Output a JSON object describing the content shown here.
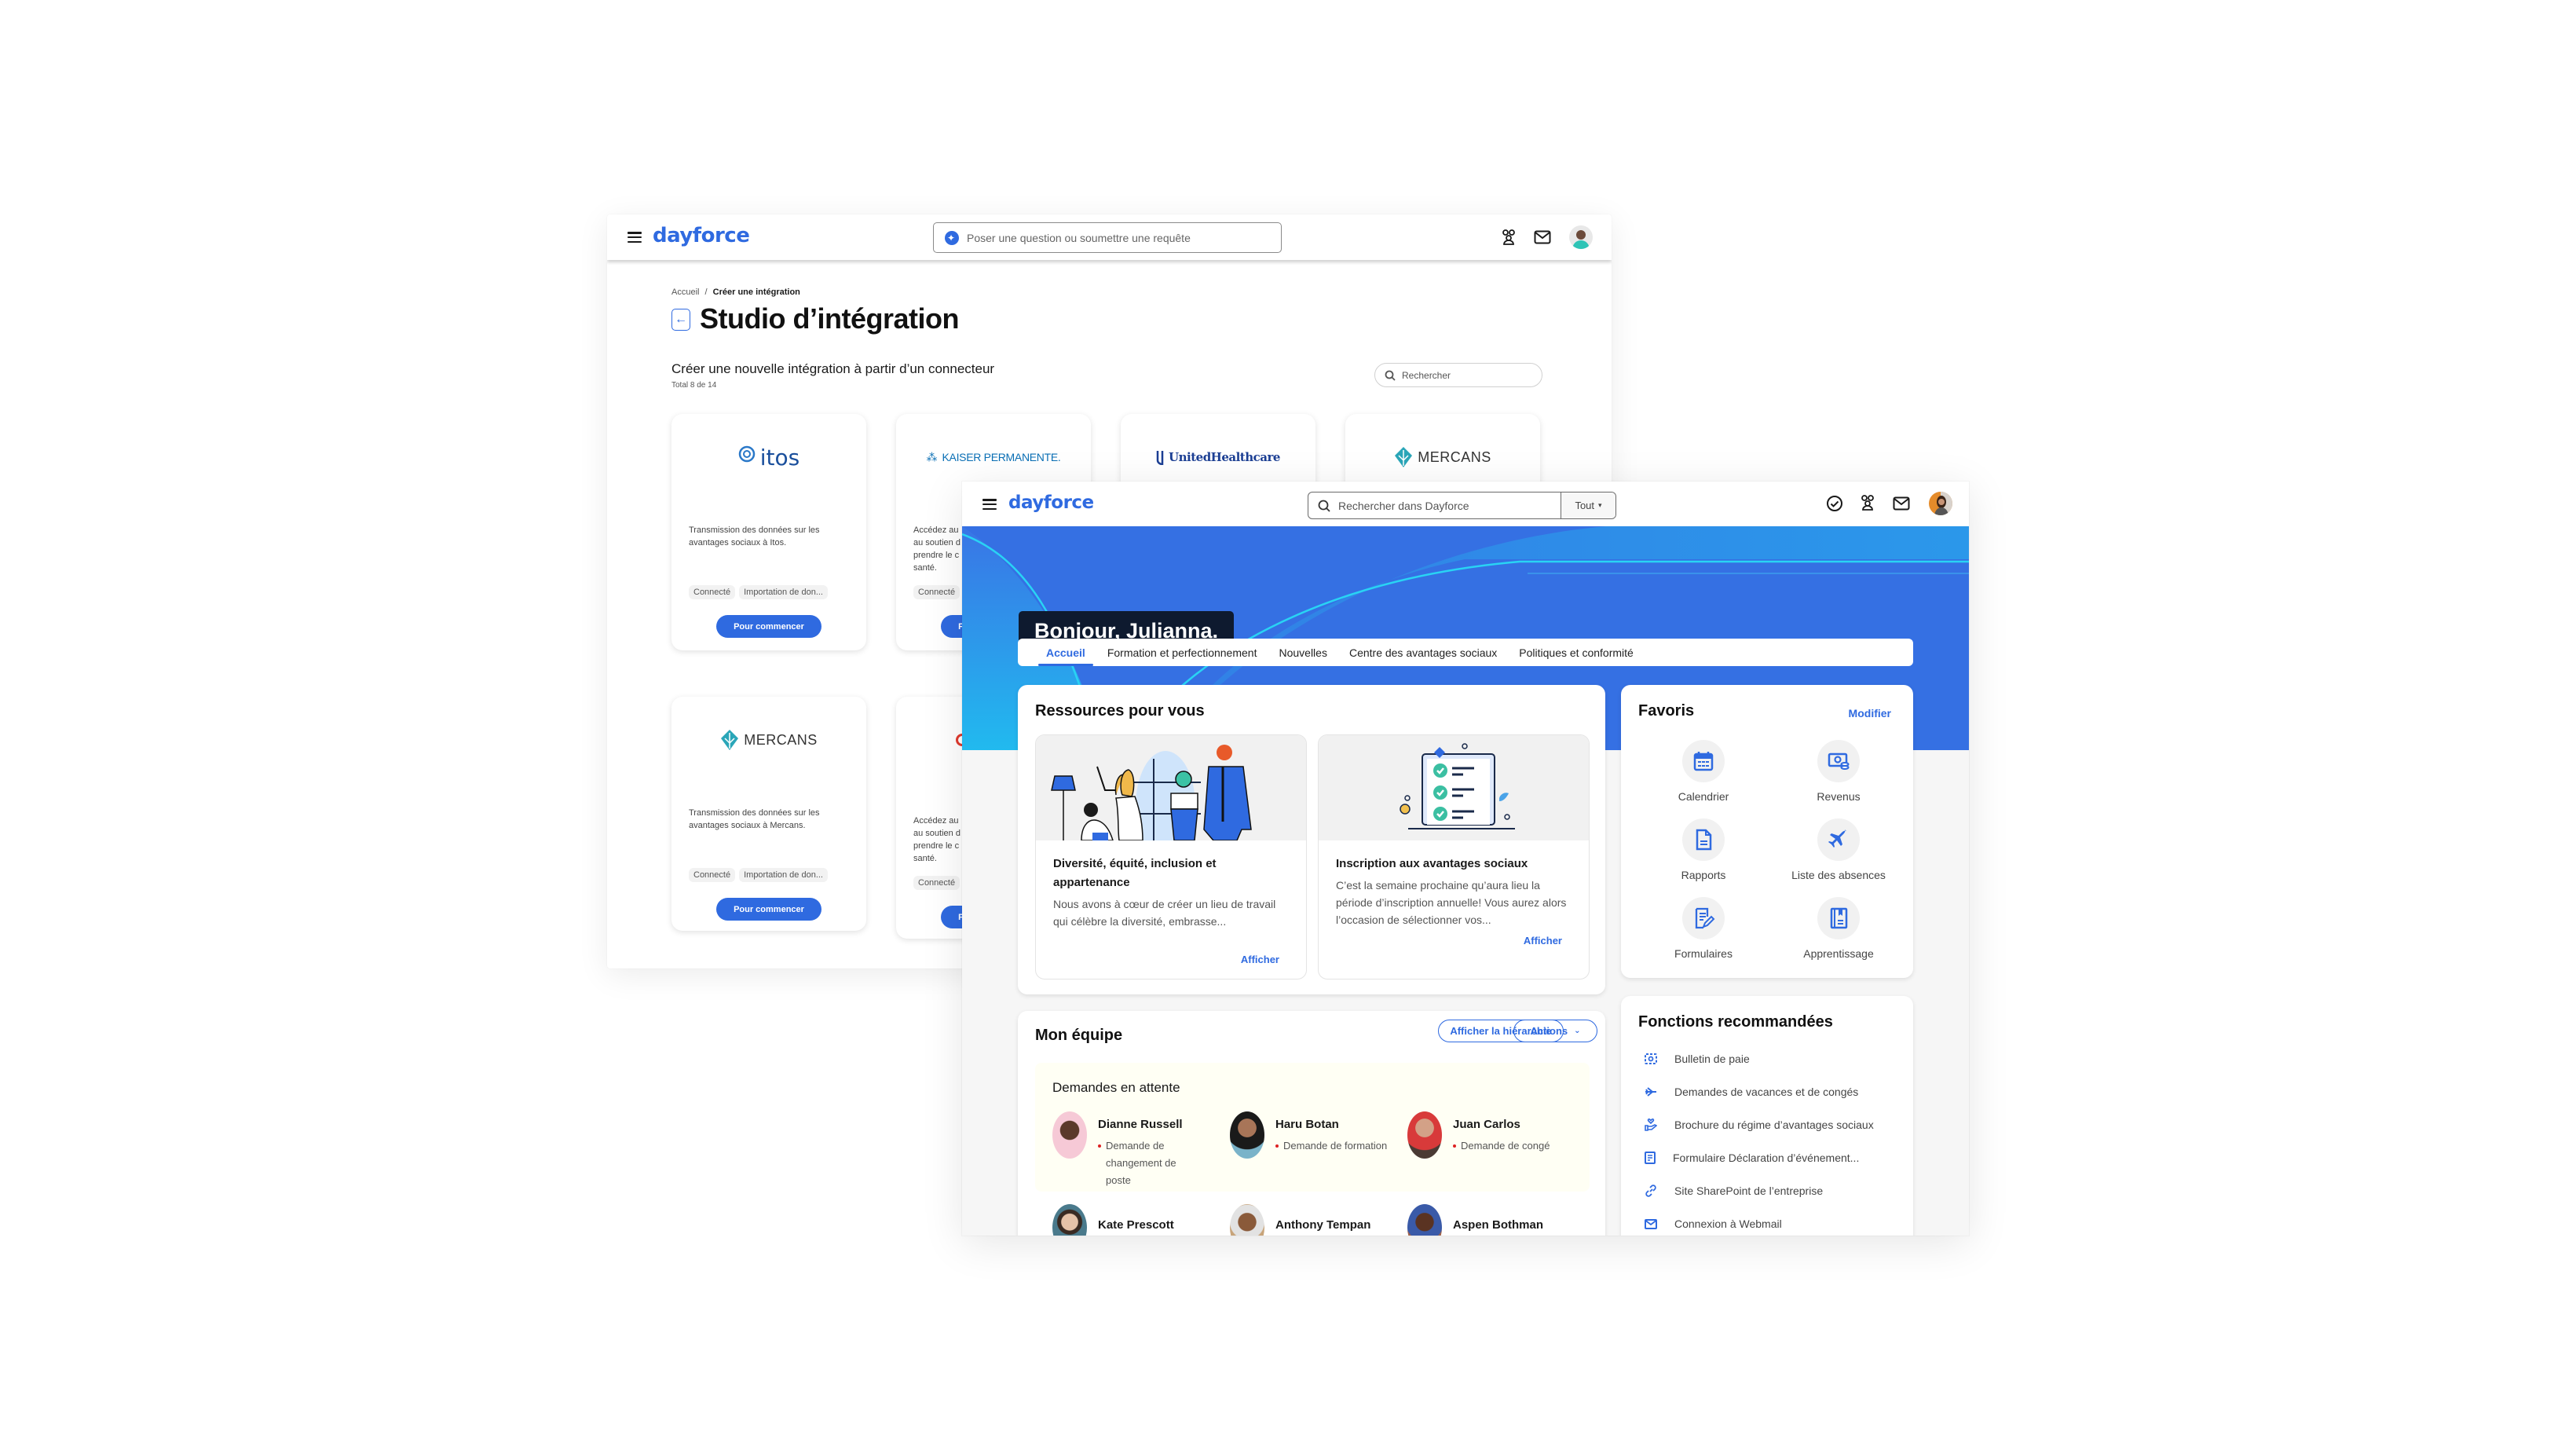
{
  "back_window": {
    "logo": "dayforce",
    "search_placeholder": "Poser une question ou soumettre une requête",
    "breadcrumb": {
      "home": "Accueil",
      "separator": "/",
      "current": "Créer une intégration"
    },
    "title": "Studio d’intégration",
    "subtitle": "Créer une nouvelle intégration à partir d’un connecteur",
    "total": "Total 8 de 14",
    "search_placeholder_connectors": "Rechercher",
    "connectors": [
      {
        "name": "itos",
        "description": "Transmission des données sur les avantages sociaux à Itos.",
        "tags": [
          "Connecté",
          "Importation de don..."
        ],
        "button": "Pour commencer"
      },
      {
        "name": "KAISER PERMANENTE.",
        "description": "Accédez aux ... au soutien d... prendre le c... santé.",
        "tags": [
          "Connecté"
        ],
        "button": "Pour commencer"
      },
      {
        "name": "UnitedHealthcare",
        "description": "",
        "tags": [],
        "button": ""
      },
      {
        "name": "MERCANS",
        "description": "",
        "tags": [],
        "button": ""
      },
      {
        "name": "MERCANS",
        "description": "Transmission des données sur les avantages sociaux à Mercans.",
        "tags": [
          "Connecté",
          "Importation de don..."
        ],
        "button": "Pour commencer"
      },
      {
        "name": "",
        "description": "Accédez aux ... au soutien d... prendre le c... santé.",
        "tags": [
          "Connecté"
        ],
        "button": "Pour commencer"
      }
    ],
    "colors": {
      "accent": "#2f6ae0"
    }
  },
  "front_window": {
    "logo": "dayforce",
    "search_placeholder": "Rechercher dans Dayforce",
    "search_scope": "Tout",
    "greeting": "Bonjour, Julianna.",
    "tabs": [
      {
        "label": "Accueil",
        "active": true
      },
      {
        "label": "Formation et perfectionnement",
        "active": false
      },
      {
        "label": "Nouvelles",
        "active": false
      },
      {
        "label": "Centre des avantages sociaux",
        "active": false
      },
      {
        "label": "Politiques et conformité",
        "active": false
      }
    ],
    "resources": {
      "title": "Ressources pour vous",
      "items": [
        {
          "title": "Diversité, équité, inclusion et appartenance",
          "body": "Nous avons à cœur de créer un lieu de travail qui célèbre la diversité, embrasse...",
          "link": "Afficher"
        },
        {
          "title": "Inscription aux avantages sociaux",
          "body": "C’est la semaine prochaine qu’aura lieu la période d’inscription annuelle! Vous aurez alors l’occasion de sélectionner vos...",
          "link": "Afficher"
        }
      ]
    },
    "favorites": {
      "title": "Favoris",
      "edit": "Modifier",
      "items": [
        {
          "label": "Calendrier",
          "icon": "calendar-icon"
        },
        {
          "label": "Revenus",
          "icon": "earnings-icon"
        },
        {
          "label": "Rapports",
          "icon": "document-icon"
        },
        {
          "label": "Liste des absences",
          "icon": "airplane-icon"
        },
        {
          "label": "Formulaires",
          "icon": "form-edit-icon"
        },
        {
          "label": "Apprentissage",
          "icon": "book-icon"
        }
      ]
    },
    "team": {
      "title": "Mon équipe",
      "hierarchy_button": "Afficher la hiérarchie",
      "actions_button": "Actions",
      "pending_title": "Demandes en attente",
      "pending": [
        {
          "name": "Dianne Russell",
          "request": "Demande de changement de poste"
        },
        {
          "name": "Haru Botan",
          "request": "Demande de formation"
        },
        {
          "name": "Juan Carlos",
          "request": "Demande de congé"
        }
      ],
      "members": [
        {
          "name": "Kate Prescott"
        },
        {
          "name": "Anthony Tempan"
        },
        {
          "name": "Aspen Bothman"
        }
      ]
    },
    "recommended": {
      "title": "Fonctions recommandées",
      "items": [
        {
          "label": "Bulletin de paie",
          "icon": "pay-stub-icon"
        },
        {
          "label": "Demandes de vacances et de congés",
          "icon": "airplane-icon"
        },
        {
          "label": "Brochure du régime d’avantages sociaux",
          "icon": "benefits-hand-heart-icon"
        },
        {
          "label": "Formulaire Déclaration d’événement...",
          "icon": "form-icon"
        },
        {
          "label": "Site SharePoint de l’entreprise",
          "icon": "link-icon"
        },
        {
          "label": "Connexion à Webmail",
          "icon": "mail-icon"
        }
      ]
    },
    "colors": {
      "accent": "#2f6ae0",
      "banner": "#3570e3",
      "greeting_bg": "#0e1a2f",
      "pending_bg": "#fffff4"
    }
  }
}
